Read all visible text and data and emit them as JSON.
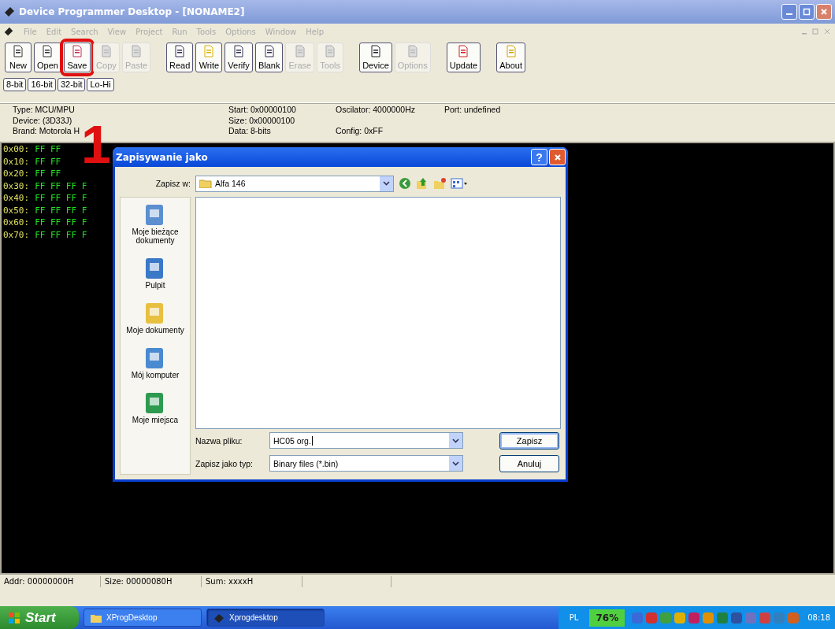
{
  "window": {
    "title": "Device Programmer Desktop - [NONAME2]"
  },
  "menu": [
    "File",
    "Edit",
    "Search",
    "View",
    "Project",
    "Run",
    "Tools",
    "Options",
    "Window",
    "Help"
  ],
  "toolbar": {
    "groups": [
      {
        "buttons": [
          {
            "label": "New",
            "disabled": false,
            "highlighted": false
          },
          {
            "label": "Open",
            "disabled": false,
            "highlighted": false
          },
          {
            "label": "Save",
            "disabled": false,
            "highlighted": true
          },
          {
            "label": "Copy",
            "disabled": true,
            "highlighted": false
          },
          {
            "label": "Paste",
            "disabled": true,
            "highlighted": false
          }
        ]
      },
      {
        "buttons": [
          {
            "label": "Read",
            "disabled": false,
            "highlighted": false
          },
          {
            "label": "Write",
            "disabled": false,
            "highlighted": false
          },
          {
            "label": "Verify",
            "disabled": false,
            "highlighted": false
          },
          {
            "label": "Blank",
            "disabled": false,
            "highlighted": false
          },
          {
            "label": "Erase",
            "disabled": true,
            "highlighted": false
          },
          {
            "label": "Tools",
            "disabled": true,
            "highlighted": false
          }
        ]
      },
      {
        "buttons": [
          {
            "label": "Device",
            "disabled": false,
            "highlighted": false
          },
          {
            "label": "Options",
            "disabled": true,
            "highlighted": false
          }
        ]
      },
      {
        "buttons": [
          {
            "label": "Update",
            "disabled": false,
            "highlighted": false
          }
        ]
      },
      {
        "buttons": [
          {
            "label": "About",
            "disabled": false,
            "highlighted": false
          }
        ]
      }
    ]
  },
  "bit_buttons": [
    "8-bit",
    "16-bit",
    "32-bit",
    "Lo-Hi"
  ],
  "info": {
    "columns": [
      [
        "Type: MCU/MPU",
        "Device: (3D33J)",
        "Brand: Motorola H"
      ],
      [
        "Start: 0x00000100",
        "Size: 0x00000100",
        "Data: 8-bits"
      ],
      [
        "Oscilator: 4000000Hz",
        "Config: 0xFF"
      ],
      [
        "Port: undefined"
      ]
    ]
  },
  "hex_rows": [
    {
      "address": "0x00:",
      "bytes": "FF FF"
    },
    {
      "address": "0x10:",
      "bytes": "FF FF"
    },
    {
      "address": "0x20:",
      "bytes": "FF FF"
    },
    {
      "address": "0x30:",
      "bytes": "FF FF FF F"
    },
    {
      "address": "0x40:",
      "bytes": "FF FF FF F"
    },
    {
      "address": "0x50:",
      "bytes": "FF FF FF F"
    },
    {
      "address": "0x60:",
      "bytes": "FF FF FF F"
    },
    {
      "address": "0x70:",
      "bytes": "FF FF FF F"
    }
  ],
  "annotation": {
    "number": "1"
  },
  "dialog": {
    "title": "Zapisywanie jako",
    "help": "?",
    "save_in_label": "Zapisz w:",
    "save_in_value": "Alfa 146",
    "places": [
      "Moje bieżące dokumenty",
      "Pulpit",
      "Moje dokumenty",
      "Mój komputer",
      "Moje miejsca"
    ],
    "file_name_label": "Nazwa pliku:",
    "file_name_value": "HC05 org.",
    "file_type_label": "Zapisz jako typ:",
    "file_type_value": "Binary files (*.bin)",
    "buttons": [
      "Zapisz",
      "Anuluj"
    ]
  },
  "status_bar": [
    "Addr: 00000000H",
    "Size: 00000080H",
    "Sum: xxxxH"
  ],
  "taskbar": {
    "start": "Start",
    "tasks": [
      {
        "label": "XProgDesktop",
        "selected": false
      },
      {
        "label": "Xprogdesktop",
        "selected": true
      }
    ],
    "language": "PL",
    "battery": "76%",
    "time": "08:18"
  }
}
